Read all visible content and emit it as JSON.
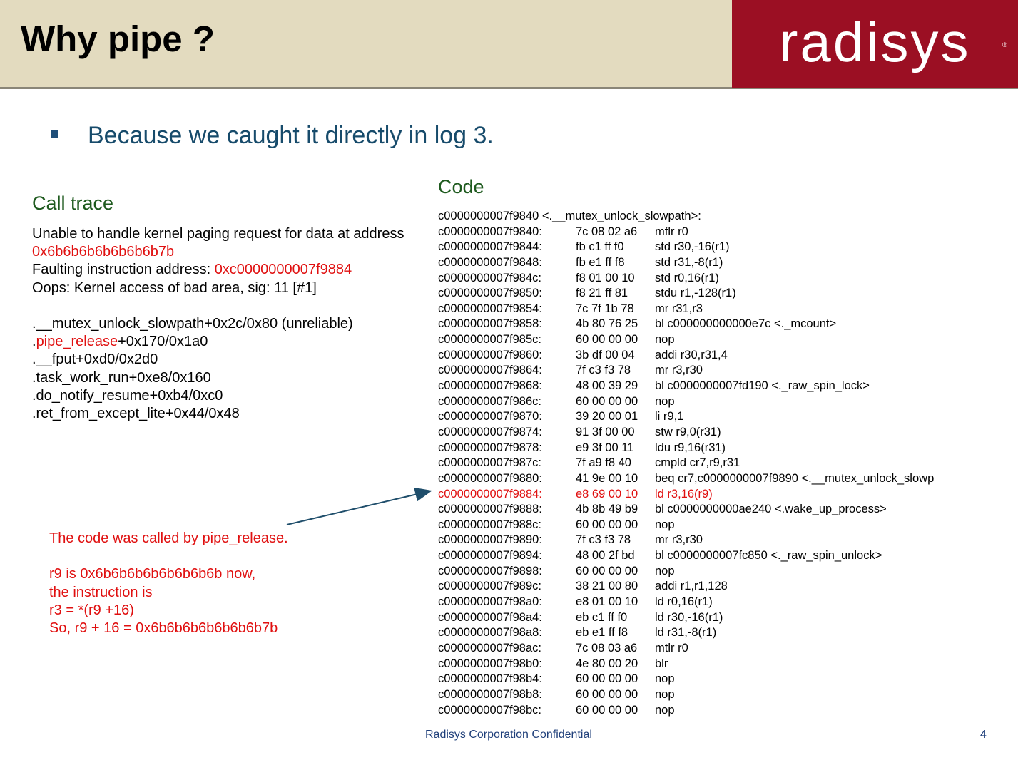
{
  "slide": {
    "title": "Why pipe ?",
    "logo": "radisys",
    "bullet": "Because we caught it directly in log 3."
  },
  "call_trace": {
    "heading": "Call trace",
    "lines": [
      [
        {
          "text": "Unable to handle kernel paging request for data at address",
          "red": false
        }
      ],
      [
        {
          "text": "0x6b6b6b6b6b6b6b7b",
          "red": true
        }
      ],
      [
        {
          "text": "Faulting instruction address: ",
          "red": false
        },
        {
          "text": "0xc0000000007f9884",
          "red": true
        }
      ],
      [
        {
          "text": "Oops: Kernel access of bad area, sig: 11 [#1]",
          "red": false
        }
      ],
      [
        {
          "text": "",
          "red": false
        }
      ],
      [
        {
          "text": ".__mutex_unlock_slowpath+0x2c/0x80 (unreliable)",
          "red": false
        }
      ],
      [
        {
          "text": ".",
          "red": false
        },
        {
          "text": "pipe_release",
          "red": true
        },
        {
          "text": "+0x170/0x1a0",
          "red": false
        }
      ],
      [
        {
          "text": ".__fput+0xd0/0x2d0",
          "red": false
        }
      ],
      [
        {
          "text": ".task_work_run+0xe8/0x160",
          "red": false
        }
      ],
      [
        {
          "text": ".do_notify_resume+0xb4/0xc0",
          "red": false
        }
      ],
      [
        {
          "text": ".ret_from_except_lite+0x44/0x48",
          "red": false
        }
      ]
    ]
  },
  "code": {
    "heading": "Code",
    "header_line": "c0000000007f9840 <.__mutex_unlock_slowpath>:",
    "rows": [
      {
        "addr": "c0000000007f9840:",
        "bytes": "7c 08 02 a6",
        "ins": "mflr    r0",
        "highlight": false
      },
      {
        "addr": "c0000000007f9844:",
        "bytes": "fb c1 ff f0",
        "ins": "std     r30,-16(r1)",
        "highlight": false
      },
      {
        "addr": "c0000000007f9848:",
        "bytes": "fb e1 ff f8",
        "ins": "std     r31,-8(r1)",
        "highlight": false
      },
      {
        "addr": "c0000000007f984c:",
        "bytes": "f8 01 00 10",
        "ins": "std     r0,16(r1)",
        "highlight": false
      },
      {
        "addr": "c0000000007f9850:",
        "bytes": "f8 21 ff 81",
        "ins": "stdu    r1,-128(r1)",
        "highlight": false
      },
      {
        "addr": "c0000000007f9854:",
        "bytes": "7c 7f 1b 78",
        "ins": "mr      r31,r3",
        "highlight": false
      },
      {
        "addr": "c0000000007f9858:",
        "bytes": "4b 80 76 25",
        "ins": "bl      c000000000000e7c <._mcount>",
        "highlight": false
      },
      {
        "addr": "c0000000007f985c:",
        "bytes": "60 00 00 00",
        "ins": "nop",
        "highlight": false
      },
      {
        "addr": "c0000000007f9860:",
        "bytes": "3b df 00 04",
        "ins": "addi    r30,r31,4",
        "highlight": false
      },
      {
        "addr": "c0000000007f9864:",
        "bytes": "7f c3 f3 78",
        "ins": "mr      r3,r30",
        "highlight": false
      },
      {
        "addr": "c0000000007f9868:",
        "bytes": "48 00 39 29",
        "ins": "bl      c0000000007fd190 <._raw_spin_lock>",
        "highlight": false
      },
      {
        "addr": "c0000000007f986c:",
        "bytes": "60 00 00 00",
        "ins": "nop",
        "highlight": false
      },
      {
        "addr": "c0000000007f9870:",
        "bytes": "39 20 00 01",
        "ins": "li      r9,1",
        "highlight": false
      },
      {
        "addr": "c0000000007f9874:",
        "bytes": "91 3f 00 00",
        "ins": "stw     r9,0(r31)",
        "highlight": false
      },
      {
        "addr": "c0000000007f9878:",
        "bytes": "e9 3f 00 11",
        "ins": "ldu     r9,16(r31)",
        "highlight": false
      },
      {
        "addr": "c0000000007f987c:",
        "bytes": "7f a9 f8 40",
        "ins": "cmpld   cr7,r9,r31",
        "highlight": false
      },
      {
        "addr": "c0000000007f9880:",
        "bytes": "41 9e 00 10",
        "ins": "beq     cr7,c0000000007f9890 <.__mutex_unlock_slowp",
        "highlight": false
      },
      {
        "addr": "c0000000007f9884:",
        "bytes": "e8 69 00 10",
        "ins": "ld      r3,16(r9)",
        "highlight": true
      },
      {
        "addr": "c0000000007f9888:",
        "bytes": "4b 8b 49 b9",
        "ins": "bl      c0000000000ae240 <.wake_up_process>",
        "highlight": false
      },
      {
        "addr": "c0000000007f988c:",
        "bytes": "60 00 00 00",
        "ins": "nop",
        "highlight": false
      },
      {
        "addr": "c0000000007f9890:",
        "bytes": "7f c3 f3 78",
        "ins": "mr      r3,r30",
        "highlight": false
      },
      {
        "addr": "c0000000007f9894:",
        "bytes": "48 00 2f bd",
        "ins": "bl      c0000000007fc850 <._raw_spin_unlock>",
        "highlight": false
      },
      {
        "addr": "c0000000007f9898:",
        "bytes": "60 00 00 00",
        "ins": "nop",
        "highlight": false
      },
      {
        "addr": "c0000000007f989c:",
        "bytes": "38 21 00 80",
        "ins": "addi    r1,r1,128",
        "highlight": false
      },
      {
        "addr": "c0000000007f98a0:",
        "bytes": "e8 01 00 10",
        "ins": "ld      r0,16(r1)",
        "highlight": false
      },
      {
        "addr": "c0000000007f98a4:",
        "bytes": "eb c1 ff f0",
        "ins": "ld      r30,-16(r1)",
        "highlight": false
      },
      {
        "addr": "c0000000007f98a8:",
        "bytes": "eb e1 ff f8",
        "ins": "ld      r31,-8(r1)",
        "highlight": false
      },
      {
        "addr": "c0000000007f98ac:",
        "bytes": "7c 08 03 a6",
        "ins": "mtlr    r0",
        "highlight": false
      },
      {
        "addr": "c0000000007f98b0:",
        "bytes": "4e 80 00 20",
        "ins": "blr",
        "highlight": false
      },
      {
        "addr": "c0000000007f98b4:",
        "bytes": "60 00 00 00",
        "ins": "nop",
        "highlight": false
      },
      {
        "addr": "c0000000007f98b8:",
        "bytes": "60 00 00 00",
        "ins": "nop",
        "highlight": false
      },
      {
        "addr": "c0000000007f98bc:",
        "bytes": "60 00 00 00",
        "ins": "nop",
        "highlight": false
      }
    ]
  },
  "annotation": {
    "lines": [
      "The code was called by pipe_release.",
      "",
      "r9 is 0x6b6b6b6b6b6b6b6b now,",
      "the instruction is",
      "r3 = *(r9 +16)",
      "So, r9 + 16 = 0x6b6b6b6b6b6b6b7b"
    ]
  },
  "footer": {
    "text": "Radisys Corporation Confidential",
    "page": "4"
  },
  "colors": {
    "header_bg": "#e3dbbf",
    "logo_bg": "#9b0f23",
    "highlight_red": "#e01010",
    "heading_green": "#1e5a1e",
    "bullet_blue": "#174b6b",
    "arrow": "#1f4e6b"
  }
}
